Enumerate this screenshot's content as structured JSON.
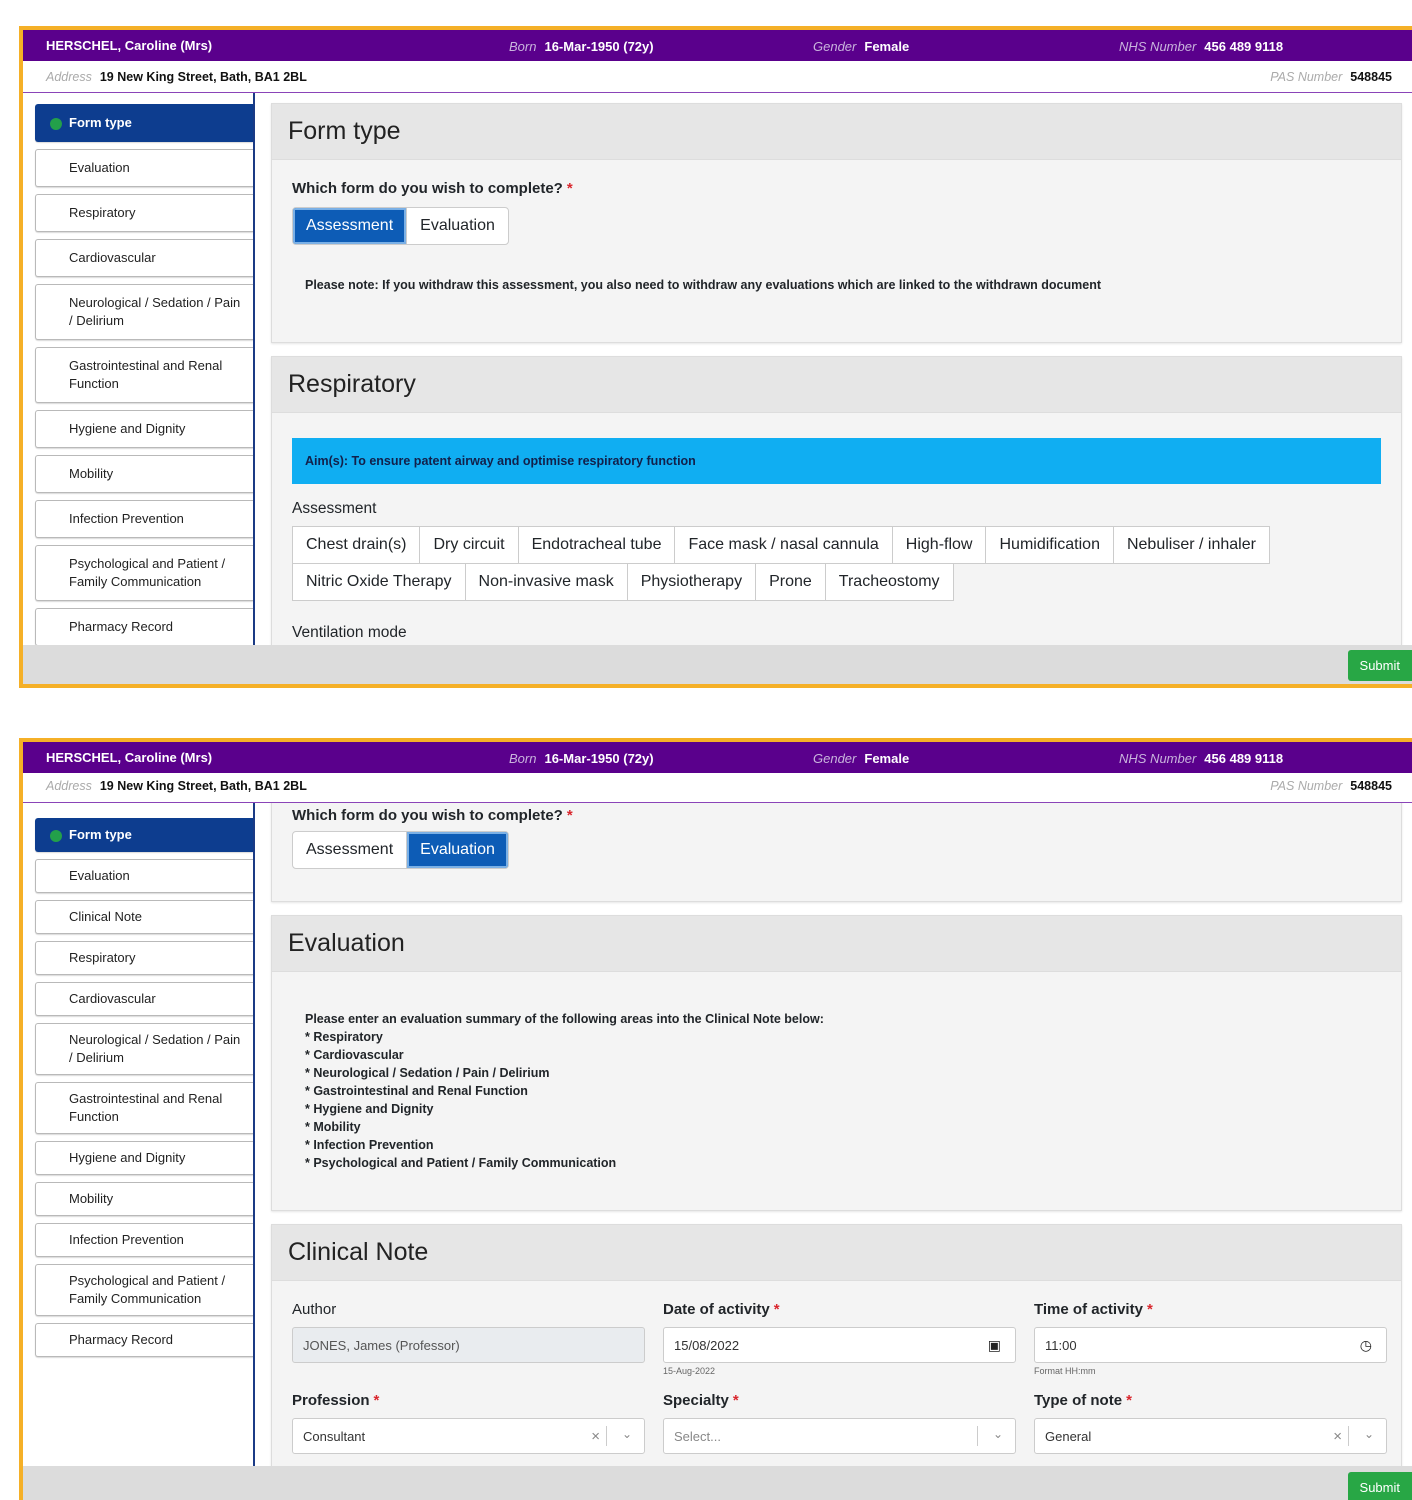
{
  "patient": {
    "name": "HERSCHEL, Caroline (Mrs)",
    "born_label": "Born",
    "born": "16-Mar-1950 (72y)",
    "gender_label": "Gender",
    "gender": "Female",
    "nhs_label": "NHS Number",
    "nhs": "456 489 9118",
    "address_label": "Address",
    "address": "19 New King Street, Bath, BA1 2BL",
    "pas_label": "PAS Number",
    "pas": "548845"
  },
  "screen1": {
    "nav": [
      "Form type",
      "Evaluation",
      "Respiratory",
      "Cardiovascular",
      "Neurological / Sedation / Pain / Delirium",
      "Gastrointestinal and Renal Function",
      "Hygiene and Dignity",
      "Mobility",
      "Infection Prevention",
      "Psychological and Patient / Family Communication",
      "Pharmacy Record"
    ],
    "form_type_title": "Form type",
    "question": "Which form do you wish to complete?",
    "required": "*",
    "options": [
      "Assessment",
      "Evaluation"
    ],
    "selected": "Assessment",
    "note": "Please note: If you withdraw this assessment, you also need to withdraw any evaluations which are linked to the withdrawn document",
    "respiratory_title": "Respiratory",
    "aim": "Aim(s): To ensure patent airway and optimise respiratory function",
    "assessment_label": "Assessment",
    "chips": [
      "Chest drain(s)",
      "Dry circuit",
      "Endotracheal tube",
      "Face mask / nasal cannula",
      "High-flow",
      "Humidification",
      "Nebuliser / inhaler",
      "Nitric Oxide Therapy",
      "Non-invasive mask",
      "Physiotherapy",
      "Prone",
      "Tracheostomy"
    ],
    "ventilation_label": "Ventilation mode",
    "submit": "Submit"
  },
  "screen2": {
    "nav": [
      "Form type",
      "Evaluation",
      "Clinical Note",
      "Respiratory",
      "Cardiovascular",
      "Neurological / Sedation / Pain / Delirium",
      "Gastrointestinal and Renal Function",
      "Hygiene and Dignity",
      "Mobility",
      "Infection Prevention",
      "Psychological and Patient / Family Communication",
      "Pharmacy Record"
    ],
    "question": "Which form do you wish to complete?",
    "options": [
      "Assessment",
      "Evaluation"
    ],
    "selected": "Evaluation",
    "evaluation_title": "Evaluation",
    "eval_intro": "Please enter an evaluation summary of the following areas into the Clinical Note below:",
    "eval_items": [
      "* Respiratory",
      "* Cardiovascular",
      "* Neurological / Sedation / Pain / Delirium",
      "* Gastrointestinal and Renal Function",
      "* Hygiene and Dignity",
      "* Mobility",
      "* Infection Prevention",
      "* Psychological and Patient / Family Communication"
    ],
    "clinical_title": "Clinical Note",
    "author_label": "Author",
    "author_value": "JONES, James (Professor)",
    "date_label": "Date of activity",
    "date_value": "15/08/2022",
    "date_hint": "15-Aug-2022",
    "time_label": "Time of activity",
    "time_value": "11:00",
    "time_hint": "Format HH:mm",
    "profession_label": "Profession",
    "profession_value": "Consultant",
    "specialty_label": "Specialty",
    "specialty_placeholder": "Select...",
    "note_type_label": "Type of note",
    "note_type_value": "General",
    "submit": "Submit"
  }
}
